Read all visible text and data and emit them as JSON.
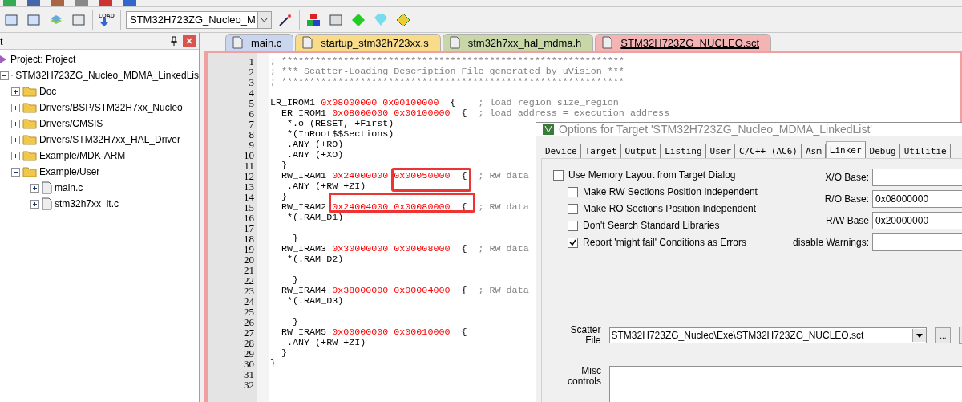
{
  "toolbar": {
    "load_label": "LOAD",
    "target": "STM32H723ZG_Nucleo_M"
  },
  "project_panel": {
    "title": "t",
    "tree": [
      {
        "label": "Project: Project",
        "kind": "project",
        "children": [
          {
            "label": "STM32H723ZG_Nucleo_MDMA_LinkedLis",
            "kind": "target",
            "expanded": true,
            "children": [
              {
                "label": "Doc",
                "kind": "folder",
                "expanded": false
              },
              {
                "label": "Drivers/BSP/STM32H7xx_Nucleo",
                "kind": "folder",
                "expanded": false
              },
              {
                "label": "Drivers/CMSIS",
                "kind": "folder",
                "expanded": false
              },
              {
                "label": "Drivers/STM32H7xx_HAL_Driver",
                "kind": "folder",
                "expanded": false
              },
              {
                "label": "Example/MDK-ARM",
                "kind": "folder",
                "expanded": false
              },
              {
                "label": "Example/User",
                "kind": "folder",
                "expanded": true,
                "children": [
                  {
                    "label": "main.c",
                    "kind": "file",
                    "expanded": false
                  },
                  {
                    "label": "stm32h7xx_it.c",
                    "kind": "file",
                    "expanded": false
                  }
                ]
              }
            ]
          }
        ]
      }
    ]
  },
  "editor": {
    "tabs": [
      {
        "label": "main.c",
        "color": "#c9d6ee",
        "selected": false
      },
      {
        "label": "startup_stm32h723xx.s",
        "color": "#f8dc8a",
        "selected": false
      },
      {
        "label": "stm32h7xx_hal_mdma.h",
        "color": "#c8d6a8",
        "selected": false
      },
      {
        "label": "STM32H723ZG_NUCLEO.sct",
        "color": "#f4b4b4",
        "selected": true
      }
    ],
    "lines": [
      {
        "number": "1",
        "segments": [
          {
            "kind": "comment",
            "text": "; *************************************************************"
          }
        ]
      },
      {
        "number": "2",
        "segments": [
          {
            "kind": "comment",
            "text": "; *** Scatter-Loading Description File generated by uVision ***"
          }
        ]
      },
      {
        "number": "3",
        "segments": [
          {
            "kind": "comment",
            "text": "; *************************************************************"
          }
        ]
      },
      {
        "number": "4"
      },
      {
        "number": "5",
        "segments": [
          {
            "kind": "code",
            "text": "LR_IROM1 "
          },
          {
            "kind": "hex",
            "text": "0x08000000 0x00100000"
          },
          {
            "kind": "code",
            "text": "  {    "
          },
          {
            "kind": "comment",
            "text": "; load region size_region"
          }
        ]
      },
      {
        "number": "6",
        "segments": [
          {
            "kind": "code",
            "text": "  ER_IROM1 "
          },
          {
            "kind": "hex",
            "text": "0x08000000 0x00100000"
          },
          {
            "kind": "code",
            "text": "  {  "
          },
          {
            "kind": "comment",
            "text": "; load address = execution address"
          }
        ]
      },
      {
        "number": "7",
        "segments": [
          {
            "kind": "code",
            "text": "   *.o (RESET, +First)"
          }
        ]
      },
      {
        "number": "8",
        "segments": [
          {
            "kind": "code",
            "text": "   *(InRoot$$Sections)"
          }
        ]
      },
      {
        "number": "9",
        "segments": [
          {
            "kind": "code",
            "text": "   .ANY (+RO)"
          }
        ]
      },
      {
        "number": "10",
        "segments": [
          {
            "kind": "code",
            "text": "   .ANY (+XO)"
          }
        ]
      },
      {
        "number": "11",
        "segments": [
          {
            "kind": "code",
            "text": "  }"
          }
        ]
      },
      {
        "number": "12",
        "segments": [
          {
            "kind": "code",
            "text": "  RW_IRAM1 "
          },
          {
            "kind": "hex",
            "text": "0x24000000 0x00050000"
          },
          {
            "kind": "code",
            "text": "  {  "
          },
          {
            "kind": "comment",
            "text": "; RW data"
          }
        ]
      },
      {
        "number": "13",
        "segments": [
          {
            "kind": "code",
            "text": "   .ANY (+RW +ZI)"
          }
        ]
      },
      {
        "number": "14",
        "segments": [
          {
            "kind": "code",
            "text": "  }"
          }
        ]
      },
      {
        "number": "15",
        "segments": [
          {
            "kind": "code",
            "text": "  RW_IRAM2 "
          },
          {
            "kind": "hex",
            "text": "0x24004000 0x00080000"
          },
          {
            "kind": "code",
            "text": "  {"
          },
          {
            "kind": "comment",
            "text": "  ; RW data"
          }
        ]
      },
      {
        "number": "16",
        "segments": [
          {
            "kind": "code",
            "text": "   *(.RAM_D1)"
          }
        ]
      },
      {
        "number": "17"
      },
      {
        "number": "18",
        "segments": [
          {
            "kind": "code",
            "text": "    }"
          }
        ]
      },
      {
        "number": "19",
        "segments": [
          {
            "kind": "code",
            "text": "  RW_IRAM3 "
          },
          {
            "kind": "hex",
            "text": "0x30000000 0x00008000"
          },
          {
            "kind": "code",
            "text": "  {  "
          },
          {
            "kind": "comment",
            "text": "; RW data"
          }
        ]
      },
      {
        "number": "20",
        "segments": [
          {
            "kind": "code",
            "text": "   *(.RAM_D2)"
          }
        ]
      },
      {
        "number": "21"
      },
      {
        "number": "22",
        "segments": [
          {
            "kind": "code",
            "text": "    }"
          }
        ]
      },
      {
        "number": "23",
        "segments": [
          {
            "kind": "code",
            "text": "  RW_IRAM4 "
          },
          {
            "kind": "hex",
            "text": "0x38000000 0x00004000"
          },
          {
            "kind": "code",
            "text": "  {  "
          },
          {
            "kind": "comment",
            "text": "; RW data"
          }
        ]
      },
      {
        "number": "24",
        "segments": [
          {
            "kind": "code",
            "text": "   *(.RAM_D3)"
          }
        ]
      },
      {
        "number": "25"
      },
      {
        "number": "26",
        "segments": [
          {
            "kind": "code",
            "text": "    }"
          }
        ]
      },
      {
        "number": "27",
        "segments": [
          {
            "kind": "code",
            "text": "  RW_IRAM5 "
          },
          {
            "kind": "hex",
            "text": "0x00000000 0x00010000"
          },
          {
            "kind": "code",
            "text": "  {"
          }
        ]
      },
      {
        "number": "28",
        "segments": [
          {
            "kind": "code",
            "text": "   .ANY (+RW +ZI)"
          }
        ]
      },
      {
        "number": "29",
        "segments": [
          {
            "kind": "code",
            "text": "  }"
          }
        ]
      },
      {
        "number": "30",
        "segments": [
          {
            "kind": "code",
            "text": "}"
          }
        ]
      },
      {
        "number": "31"
      },
      {
        "number": "32"
      }
    ]
  },
  "dialog": {
    "title": "Options for Target 'STM32H723ZG_Nucleo_MDMA_LinkedList'",
    "tabs": [
      {
        "label": "Device",
        "selected": false
      },
      {
        "label": "Target",
        "selected": false
      },
      {
        "label": "Output",
        "selected": false
      },
      {
        "label": "Listing",
        "selected": false
      },
      {
        "label": "User",
        "selected": false
      },
      {
        "label": "C/C++ (AC6)",
        "selected": false
      },
      {
        "label": "Asm",
        "selected": false
      },
      {
        "label": "Linker",
        "selected": true
      },
      {
        "label": "Debug",
        "selected": false
      },
      {
        "label": "Utilitie",
        "selected": false
      }
    ],
    "checkboxes": [
      {
        "label": "Use Memory Layout from Target Dialog",
        "checked": false,
        "indented": false
      },
      {
        "label": "Make RW Sections Position Independent",
        "checked": false,
        "indented": true
      },
      {
        "label": "Make RO Sections Position Independent",
        "checked": false,
        "indented": true
      },
      {
        "label": "Don't Search Standard Libraries",
        "checked": false,
        "indented": true
      },
      {
        "label": "Report 'might fail' Conditions as Errors",
        "checked": true,
        "indented": true
      }
    ],
    "fields": [
      {
        "label": "X/O Base:"
      },
      {
        "label": "R/O Base:",
        "value": "0x08000000"
      },
      {
        "label": "R/W Base",
        "value": "0x20000000"
      },
      {
        "label": "disable Warnings:"
      }
    ],
    "scatter": {
      "label": "Scatter File",
      "value": "STM32H723ZG_Nucleo\\Exe\\STM32H723ZG_NUCLEO.sct",
      "browse": "..."
    },
    "misc": {
      "label": "Misc controls"
    }
  }
}
